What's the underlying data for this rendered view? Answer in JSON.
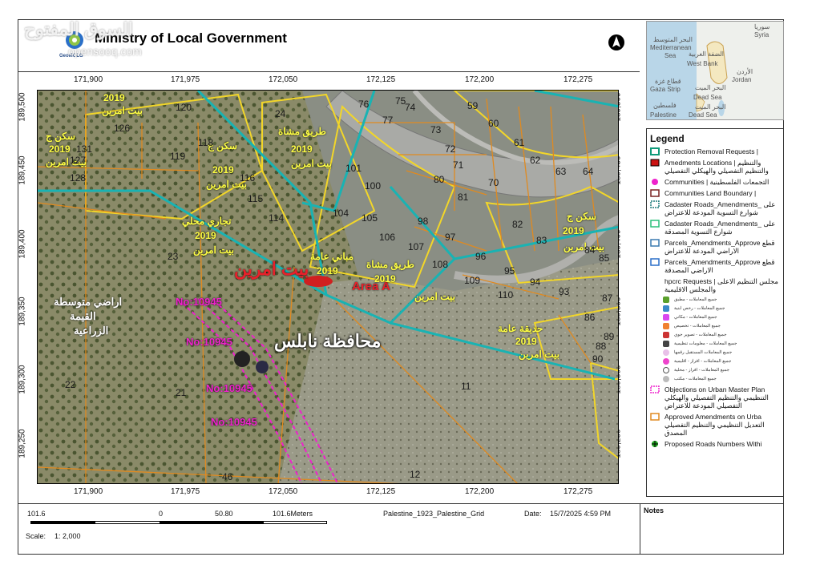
{
  "header": {
    "title": "Ministry of Local Government",
    "logo_text": "GeoMOLG",
    "watermark": "السوق المفتوح",
    "watermark_sub": "opensooq.com"
  },
  "inset_map": {
    "labels": {
      "syria_ar": "سوريا",
      "syria": "Syria",
      "med_ar": "البحر المتوسط",
      "med": "Mediterranean",
      "sea": "Sea",
      "westbank_ar": "الضفة الغربية",
      "westbank": "West Bank",
      "jordan_ar": "الأردن",
      "jordan": "Jordan",
      "gaza_ar": "قطاع غزة",
      "gaza": "Gaza Strip",
      "deadsea_ar": "البحر الميت",
      "deadsea": "Dead Sea",
      "pal_ar": "فلسطين",
      "palestine": "Palestine",
      "deadsea2_ar": "البحر الميت",
      "deadsea2": "Dead Sea"
    }
  },
  "map": {
    "x_ticks": [
      "171,900",
      "171,975",
      "172,050",
      "172,125",
      "172,200",
      "172,275"
    ],
    "y_ticks": [
      "189,500",
      "189,450",
      "189,400",
      "189,350",
      "189,300",
      "189,250"
    ],
    "governorate_label": "محافظة نابلس",
    "village_label": "بيت امرين",
    "area_label": "Area A",
    "objection_labels": [
      "No:10945",
      "No:10945",
      "No:10945",
      "No:10945"
    ],
    "agri_label_1": "اراضي متوسطة",
    "agri_label_2": "القيمة",
    "agri_label_3": "الزراعية",
    "yellow_labels": [
      "2019",
      "بيت امرين",
      "سكن ج",
      "2019",
      "بيت امرين",
      "تجاري محلي",
      "2019",
      "بيت امرين",
      "سكن ج",
      "2019",
      "بيت امرين",
      "مباني عامة",
      "2019",
      "بيت امرين",
      "حديقة عامة",
      "2019",
      "بيت امرين",
      "سكن ج",
      "2019",
      "بيت امرين",
      "طريق مشاة",
      "2019",
      "بيت امرين",
      "طريق مشاة",
      "2019"
    ],
    "parcels": [
      "126",
      "127",
      "128",
      "119",
      "118",
      "116",
      "115",
      "114",
      "23",
      "24",
      "22",
      "21",
      "46",
      "12",
      "11",
      "104",
      "105",
      "106",
      "107",
      "101",
      "100",
      "98",
      "97",
      "96",
      "95",
      "94",
      "93",
      "109",
      "110",
      "108",
      "76",
      "77",
      "75",
      "74",
      "73",
      "72",
      "71",
      "70",
      "80",
      "81",
      "59",
      "60",
      "61",
      "62",
      "63",
      "64",
      "82",
      "83",
      "84",
      "85",
      "86",
      "87",
      "88",
      "89",
      "90",
      "120",
      "131"
    ]
  },
  "legend": {
    "title": "Legend",
    "items": [
      {
        "label": "Protection Removal Requests |",
        "color": "#0f9a7a"
      },
      {
        "label": "Amedments Locations | والتنظيم والتنظيم التفصيلي والهيكلي التفصيلي",
        "color": "#cc1111"
      },
      {
        "label": "Communities | التجمعات الفلسطينية",
        "color": "#ee22cc"
      },
      {
        "label": "Communities Land Boundary |",
        "color": "#7a2222"
      },
      {
        "label": "Cadaster Roads_Amendments_ على شوارع التسوية المودعة للاعتراض",
        "color": "#1b7a7a"
      },
      {
        "label": "Cadaster Roads_Amendments_ على شوارع التسوية المصدقة",
        "color": "#2cbf7a"
      },
      {
        "label": "Parcels_Amendments_Approve قطع الاراضي المودعة للاعتراض",
        "color": "#3a7ab0"
      },
      {
        "label": "Parcels_Amendments_Approve قطع الاراضي المصدقة",
        "color": "#2a6fc8"
      },
      {
        "label": "hpcrc Requests | مجلس التنظيم الاعلى والمجلس الاقليمية",
        "color": "#ffffff"
      }
    ],
    "sub_items": [
      {
        "label": "جميع المعاملات - مطبق",
        "color": "#5aa02c"
      },
      {
        "label": "جميع المعاملات - رخص ابنية",
        "color": "#3a8ac8"
      },
      {
        "label": "جميع المعاملات - مكاني",
        "color": "#d946ef"
      },
      {
        "label": "جميع المعاملات - تخصيص",
        "color": "#f08030"
      },
      {
        "label": "جميع المعاملات - تصوير جوي",
        "color": "#cc3333"
      },
      {
        "label": "جميع المعاملات - معلومات تنظيمية",
        "color": "#444444"
      },
      {
        "label": "جميع المعاملات المستقبل رقمها",
        "color": "#e8c0e8"
      },
      {
        "label": "جميع المعاملات - افراز - اقليمية",
        "color": "#ee44cc"
      },
      {
        "label": "جميع المعاملات - افراز - محلية",
        "color": "#ffffff"
      },
      {
        "label": "جميع المعاملات - مكتب",
        "color": "#bbbbbb"
      }
    ],
    "bottom_items": [
      {
        "label": "Objections on Urban Master Plan التنظيمي والتنظيم التفصيلي والهيكلي التفصيلي المودعة للاعتراض",
        "color": "#ee22cc"
      },
      {
        "label": "Approved Amendments on Urba التعديل التنظيمي والتنظيم التفصيلي المصدق",
        "color": "#e08a20"
      },
      {
        "label": "Proposed Roads Numbers Withi",
        "color": "#22aa22"
      }
    ]
  },
  "footer": {
    "scale_left": "101.6",
    "scale_zero": "0",
    "scale_mid": "50.80",
    "scale_right": "101.6Meters",
    "grid": "Palestine_1923_Palestine_Grid",
    "date_label": "Date:",
    "date_value": "15/7/2025 4:59 PM",
    "scale_label": "Scale:",
    "scale_value": "1: 2,000",
    "notes": "Notes"
  }
}
